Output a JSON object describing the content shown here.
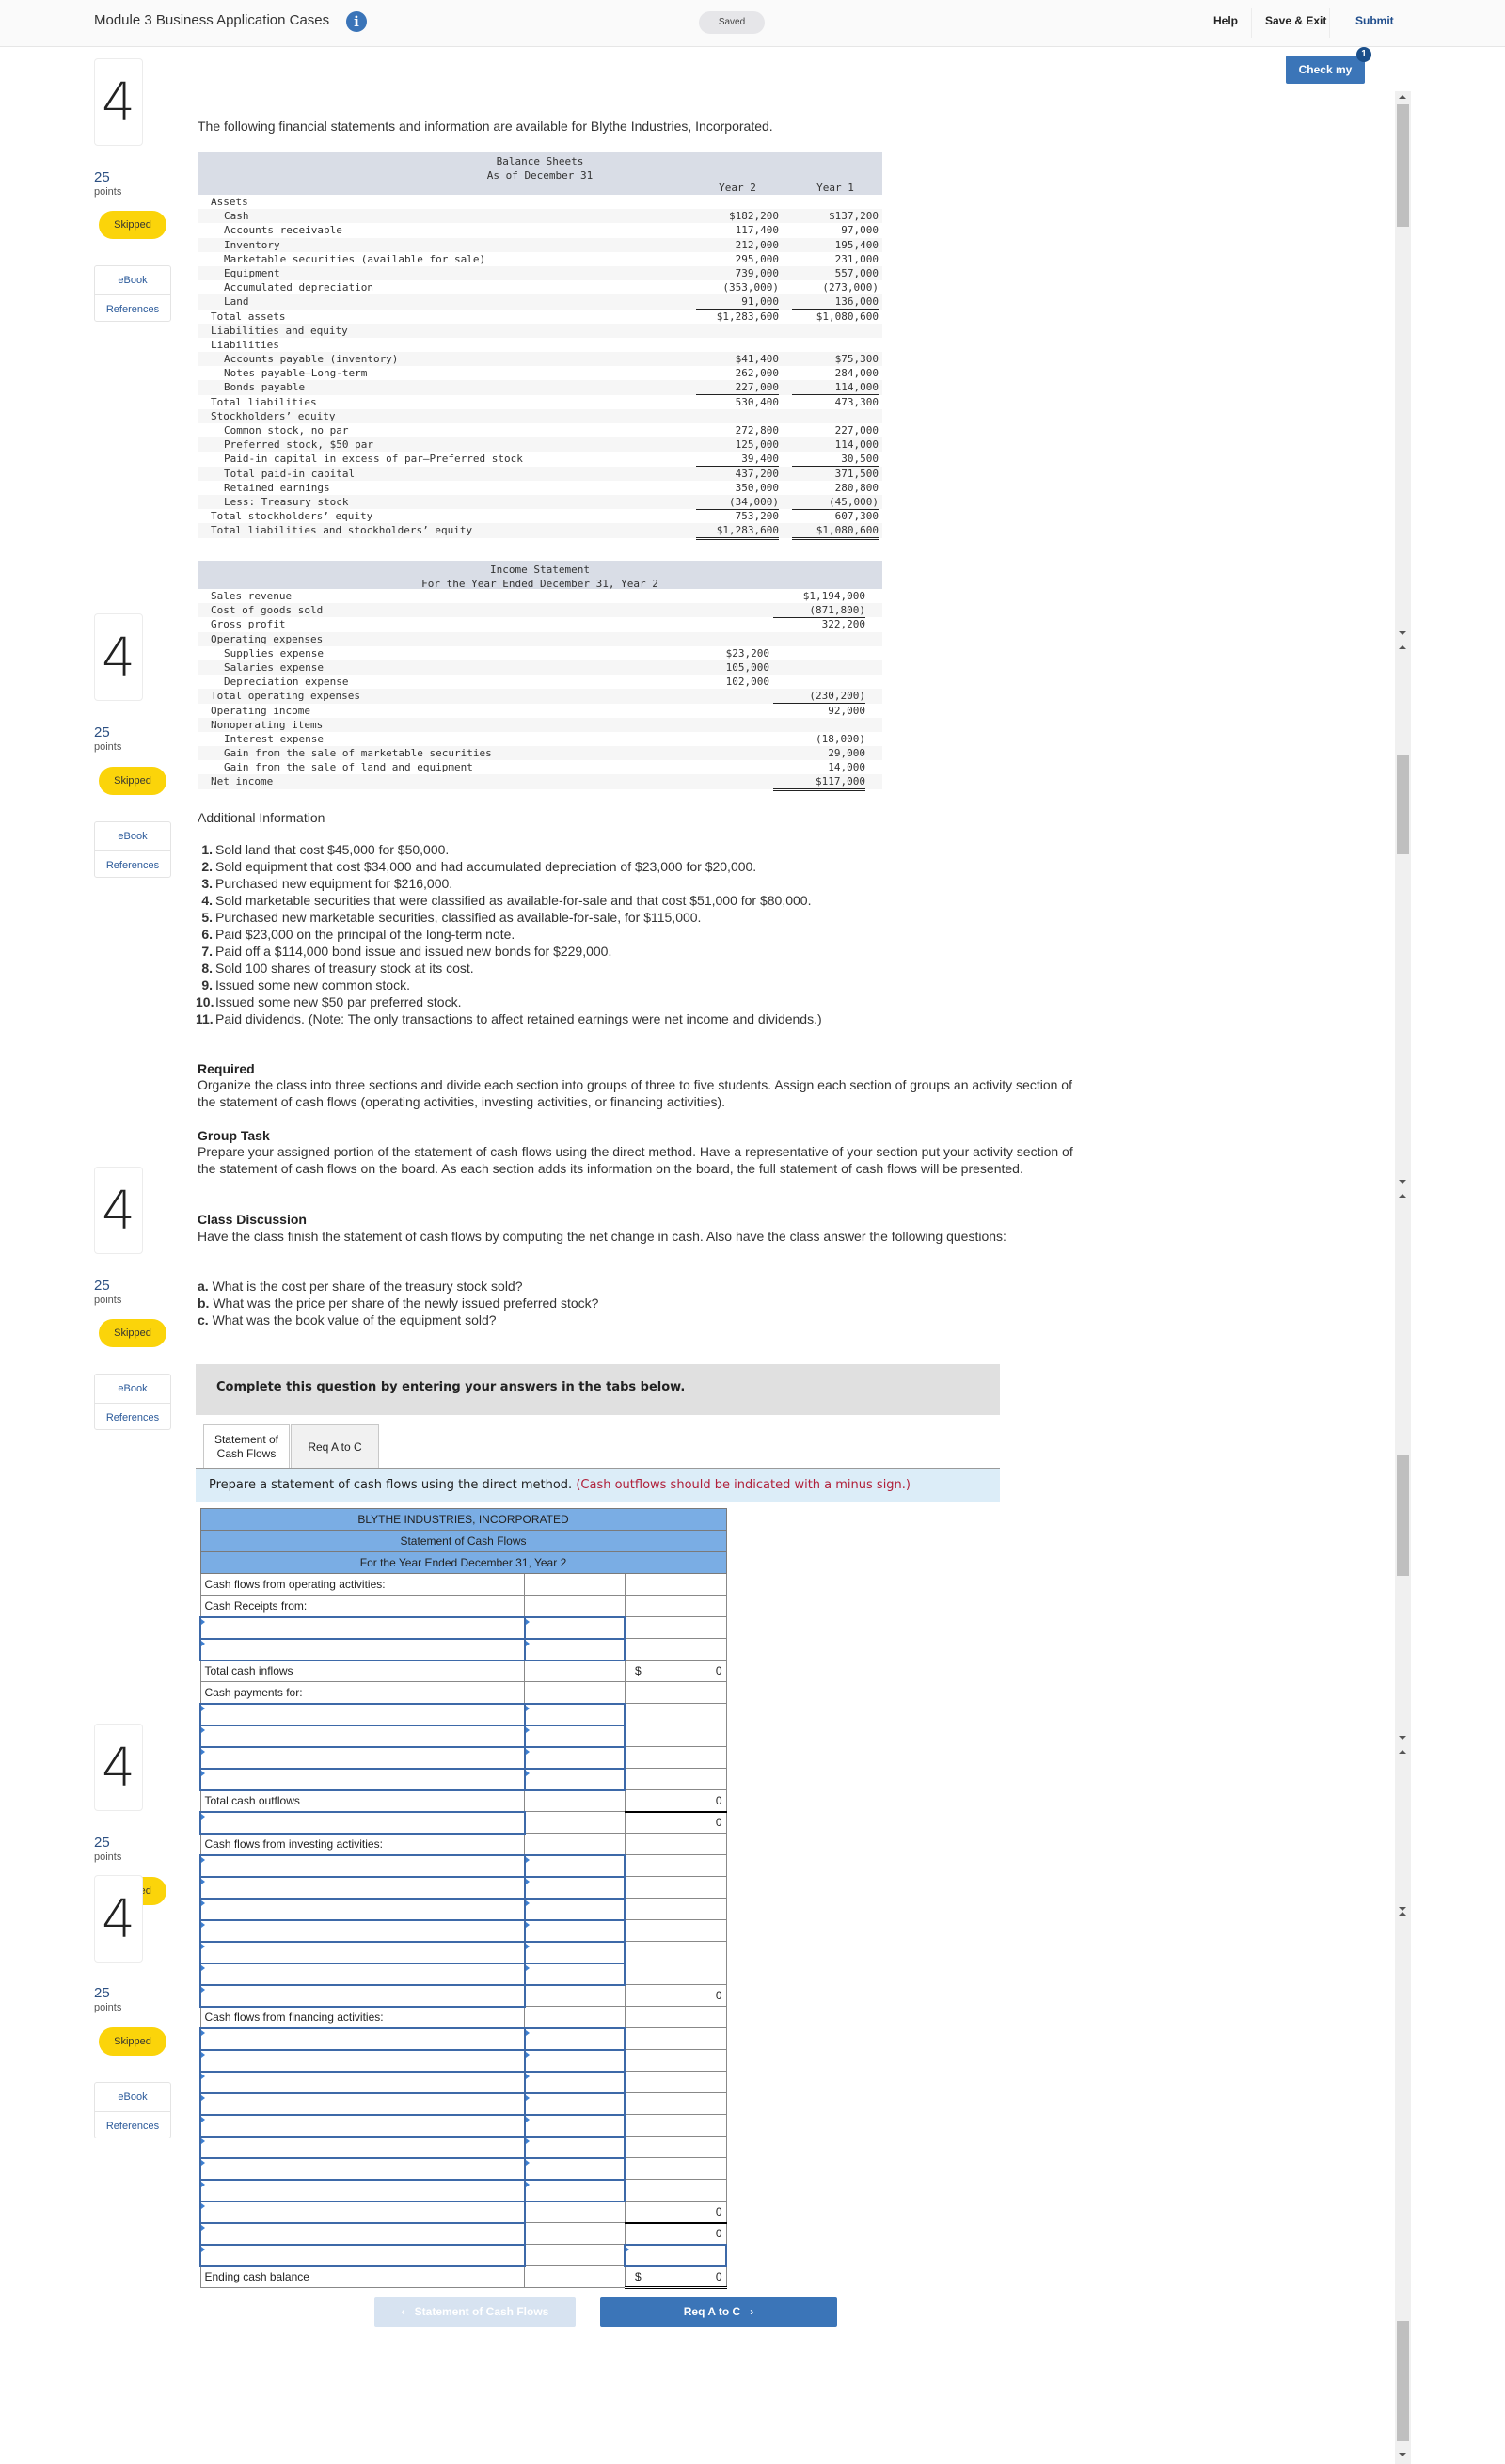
{
  "header": {
    "title": "Module 3 Business Application Cases",
    "info_icon": "info-icon",
    "status": "Saved",
    "nav": {
      "help": "Help",
      "save_exit": "Save & Exit",
      "submit": "Submit"
    },
    "check_work": "Check my work",
    "check_badge": "1"
  },
  "sidebar": {
    "question_number": "4",
    "points_value": "25",
    "points_label": "points",
    "status": "Skipped",
    "ebook": "eBook",
    "references": "References"
  },
  "intro": "The following financial statements and information are available for Blythe Industries, Incorporated.",
  "balance_sheet": {
    "title": "Balance Sheets",
    "subtitle": "As of December 31",
    "col_headers": [
      "Year 2",
      "Year 1"
    ],
    "rows": [
      {
        "label": "Assets",
        "y2": "",
        "y1": "",
        "indent": false
      },
      {
        "label": "Cash",
        "y2": "$182,200",
        "y1": "$137,200",
        "indent": true
      },
      {
        "label": "Accounts receivable",
        "y2": "117,400",
        "y1": "97,000",
        "indent": true
      },
      {
        "label": "Inventory",
        "y2": "212,000",
        "y1": "195,400",
        "indent": true
      },
      {
        "label": "Marketable securities (available for sale)",
        "y2": "295,000",
        "y1": "231,000",
        "indent": true
      },
      {
        "label": "Equipment",
        "y2": "739,000",
        "y1": "557,000",
        "indent": true
      },
      {
        "label": "Accumulated depreciation",
        "y2": "(353,000)",
        "y1": "(273,000)",
        "indent": true
      },
      {
        "label": "Land",
        "y2": "91,000",
        "y1": "136,000",
        "indent": true,
        "line": "ul"
      },
      {
        "label": "Total assets",
        "y2": "$1,283,600",
        "y1": "$1,080,600",
        "indent": false,
        "line": "dul"
      },
      {
        "label": "Liabilities and equity",
        "y2": "",
        "y1": "",
        "indent": false
      },
      {
        "label": "Liabilities",
        "y2": "",
        "y1": "",
        "indent": false
      },
      {
        "label": "Accounts payable (inventory)",
        "y2": "$41,400",
        "y1": "$75,300",
        "indent": true
      },
      {
        "label": "Notes payable—Long-term",
        "y2": "262,000",
        "y1": "284,000",
        "indent": true
      },
      {
        "label": "Bonds payable",
        "y2": "227,000",
        "y1": "114,000",
        "indent": true,
        "line": "ul"
      },
      {
        "label": "Total liabilities",
        "y2": "530,400",
        "y1": "473,300",
        "indent": false,
        "line": "ul"
      },
      {
        "label": "Stockholders’ equity",
        "y2": "",
        "y1": "",
        "indent": false
      },
      {
        "label": "Common stock, no par",
        "y2": "272,800",
        "y1": "227,000",
        "indent": true
      },
      {
        "label": "Preferred stock, $50 par",
        "y2": "125,000",
        "y1": "114,000",
        "indent": true
      },
      {
        "label": "Paid-in capital in excess of par—Preferred stock",
        "y2": "39,400",
        "y1": "30,500",
        "indent": true,
        "line": "ul"
      },
      {
        "label": "Total paid-in capital",
        "y2": "437,200",
        "y1": "371,500",
        "indent": true
      },
      {
        "label": "Retained earnings",
        "y2": "350,000",
        "y1": "280,800",
        "indent": true
      },
      {
        "label": "Less: Treasury stock",
        "y2": "(34,000)",
        "y1": "(45,000)",
        "indent": true,
        "line": "ul"
      },
      {
        "label": "Total stockholders’ equity",
        "y2": "753,200",
        "y1": "607,300",
        "indent": false
      },
      {
        "label": "Total liabilities and stockholders’ equity",
        "y2": "$1,283,600",
        "y1": "$1,080,600",
        "indent": false,
        "line": "dul"
      }
    ]
  },
  "income_statement": {
    "title": "Income Statement",
    "subtitle": "For the Year Ended December 31, Year 2",
    "rows": [
      {
        "label": "Sales revenue",
        "c1": "",
        "c2": "$1,194,000",
        "indent": false
      },
      {
        "label": "Cost of goods sold",
        "c1": "",
        "c2": "(871,800)",
        "indent": false,
        "line2": "ul"
      },
      {
        "label": "Gross profit",
        "c1": "",
        "c2": "322,200",
        "indent": false
      },
      {
        "label": "Operating expenses",
        "c1": "",
        "c2": "",
        "indent": false
      },
      {
        "label": "Supplies expense",
        "c1": "$23,200",
        "c2": "",
        "indent": true
      },
      {
        "label": "Salaries expense",
        "c1": "105,000",
        "c2": "",
        "indent": true
      },
      {
        "label": "Depreciation expense",
        "c1": "102,000",
        "c2": "",
        "indent": true,
        "line1": "ul"
      },
      {
        "label": "Total operating expenses",
        "c1": "",
        "c2": "(230,200)",
        "indent": false,
        "line2": "ul"
      },
      {
        "label": "Operating income",
        "c1": "",
        "c2": "92,000",
        "indent": false
      },
      {
        "label": "Nonoperating items",
        "c1": "",
        "c2": "",
        "indent": false
      },
      {
        "label": "Interest expense",
        "c1": "",
        "c2": "(18,000)",
        "indent": true
      },
      {
        "label": "Gain from the sale of marketable securities",
        "c1": "",
        "c2": "29,000",
        "indent": true
      },
      {
        "label": "Gain from the sale of land and equipment",
        "c1": "",
        "c2": "14,000",
        "indent": true,
        "line2": "ul"
      },
      {
        "label": "Net income",
        "c1": "",
        "c2": "$117,000",
        "indent": false,
        "line2": "dul"
      }
    ]
  },
  "additional_info": {
    "title": "Additional Information",
    "items": [
      "Sold land that cost $45,000 for $50,000.",
      "Sold equipment that cost $34,000 and had accumulated depreciation of $23,000 for $20,000.",
      "Purchased new equipment for $216,000.",
      "Sold marketable securities that were classified as available-for-sale and that cost $51,000 for $80,000.",
      "Purchased new marketable securities, classified as available-for-sale, for $115,000.",
      "Paid $23,000 on the principal of the long-term note.",
      "Paid off a $114,000 bond issue and issued new bonds for $229,000.",
      "Sold 100 shares of treasury stock at its cost.",
      "Issued some new common stock.",
      "Issued some new $50 par preferred stock.",
      "Paid dividends. (Note: The only transactions to affect retained earnings were net income and dividends.)"
    ]
  },
  "required": {
    "title": "Required",
    "text": "Organize the class into three sections and divide each section into groups of three to five students. Assign each section of groups an activity section of the statement of cash flows (operating activities, investing activities, or financing activities)."
  },
  "group_task": {
    "title": "Group Task",
    "text": "Prepare your assigned portion of the statement of cash flows using the direct method. Have a representative of your section put your activity section of the statement of cash flows on the board. As each section adds its information on the board, the full statement of cash flows will be presented."
  },
  "class_discussion": {
    "title": "Class Discussion",
    "text": "Have the class finish the statement of cash flows by computing the net change in cash. Also have the class answer the following questions:",
    "questions": [
      {
        "letter": "a.",
        "text": "What is the cost per share of the treasury stock sold?"
      },
      {
        "letter": "b.",
        "text": "What was the price per share of the newly issued preferred stock?"
      },
      {
        "letter": "c.",
        "text": "What was the book value of the equipment sold?"
      }
    ]
  },
  "answer_area": {
    "instructions_bar": "Complete this question by entering your answers in the tabs below.",
    "tabs": [
      {
        "label": "Statement of Cash Flows",
        "active": true
      },
      {
        "label": "Req A to C",
        "active": false
      }
    ],
    "prompt": "Prepare a statement of cash flows using the direct method.",
    "prompt_note": "(Cash outflows should be indicated with a minus sign.)",
    "statement": {
      "company": "BLYTHE INDUSTRIES, INCORPORATED",
      "title": "Statement of Cash Flows",
      "period": "For the Year Ended December 31, Year 2",
      "labels": {
        "operating": "Cash flows from operating activities:",
        "receipts": "Cash Receipts from:",
        "total_inflows": "Total cash inflows",
        "payments": "Cash payments for:",
        "total_outflows": "Total cash outflows",
        "investing": "Cash flows from investing activities:",
        "financing": "Cash flows from financing activities:",
        "ending": "Ending cash balance"
      },
      "values": {
        "total_inflows": "0",
        "total_outflows": "0",
        "net_operating": "0",
        "net_investing": "0",
        "net_financing": "0",
        "net_change": "0",
        "ending": "0",
        "currency": "$"
      }
    },
    "nav_prev": "Statement of Cash Flows",
    "nav_next": "Req A to C"
  }
}
